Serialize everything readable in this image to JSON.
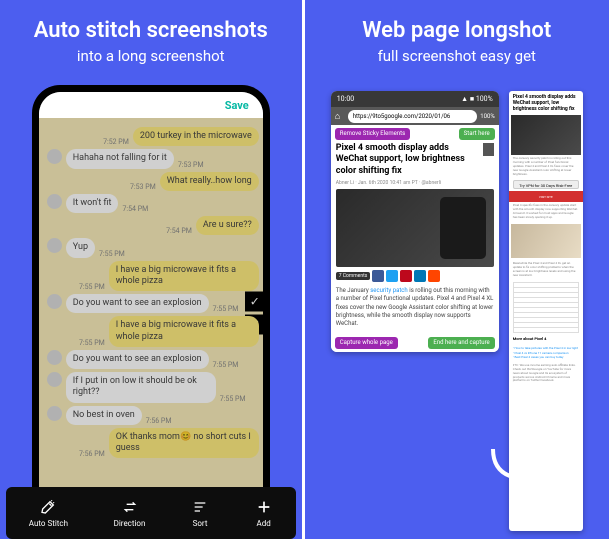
{
  "left": {
    "headline": "Auto stitch screenshots",
    "subhead": "into a long screenshot",
    "save_label": "Save",
    "toolbar": [
      {
        "label": "Auto Stitch",
        "icon": "wand"
      },
      {
        "label": "Direction",
        "icon": "swap"
      },
      {
        "label": "Sort",
        "icon": "sort"
      },
      {
        "label": "Add",
        "icon": "plus"
      }
    ],
    "chat": [
      {
        "side": "right",
        "text": "200 turkey in the microwave",
        "ts": "7:52 PM"
      },
      {
        "side": "left",
        "text": "Hahaha not falling for it",
        "ts": "7:53 PM"
      },
      {
        "side": "right",
        "text": "What really..how long",
        "ts": "7:53 PM"
      },
      {
        "side": "left",
        "text": "It won't fit",
        "ts": "7:54 PM"
      },
      {
        "side": "right",
        "text": "Are u sure??",
        "ts": "7:54 PM"
      },
      {
        "side": "left",
        "text": "Yup",
        "ts": "7:55 PM"
      },
      {
        "side": "right",
        "text": "I have a big microwave it fits a whole pizza",
        "ts": "7:55 PM"
      },
      {
        "side": "left",
        "text": "Do you want to see an explosion",
        "ts": "7:55 PM"
      },
      {
        "side": "right",
        "text": "I have a big microwave it fits a whole pizza",
        "ts": "7:55 PM"
      },
      {
        "side": "left",
        "text": "Do you want to see an explosion",
        "ts": "7:55 PM"
      },
      {
        "side": "left",
        "text": "If I put in on low it should be ok right??",
        "ts": "7:55 PM"
      },
      {
        "side": "left",
        "text": "No best in oven",
        "ts": "7:56 PM"
      },
      {
        "side": "right",
        "text": "OK thanks mom😊 no short cuts I guess",
        "ts": "7:56 PM"
      }
    ]
  },
  "right": {
    "headline": "Web page longshot",
    "subhead": "full screenshot easy get",
    "status_time": "10:00",
    "status_pct": "100%",
    "url": "https://9to5google.com/2020/01/06",
    "remove_sticky": "Remove Sticky Elements",
    "start_here": "Start here",
    "capture_whole": "Capture whole page",
    "end_here": "End here and capture",
    "article_title": "Pixel 4 smooth display adds WeChat support, low brightness color shifting fix",
    "byline": "Abner Li · Jan. 6th 2020 10:41 am PT · @abnerli",
    "comments": "7 Comments",
    "body1": "The January ",
    "body_link": "security patch",
    "body2": " is rolling out this morning with a number of Pixel functional updates. Pixel 4 and Pixel 4 XL fixes cover the new Google Assistant color shifting at lower brightness, while the smooth display now supports WeChat.",
    "ls_title": "Pixel 4 smooth display adds WeChat support, low brightness color shifting fix",
    "ls_vpn": "Try VPN for 30 Days Risk-Free",
    "ls_red": "VISIT SITE",
    "ls_more": "More about Pixel 4"
  }
}
